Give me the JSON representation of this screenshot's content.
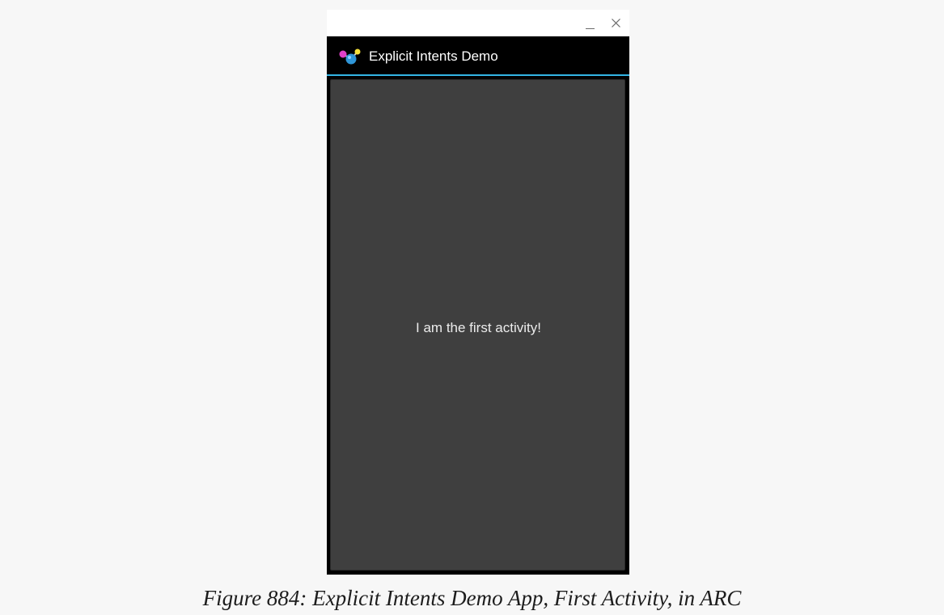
{
  "window": {
    "minimize_label": "_",
    "close_label": "×"
  },
  "app": {
    "title": "Explicit Intents Demo",
    "icon": "molecule-icon",
    "accent_color": "#33b5e5"
  },
  "activity": {
    "message": "I am the first activity!"
  },
  "caption": "Figure 884: Explicit Intents Demo App, First Activity, in ARC"
}
